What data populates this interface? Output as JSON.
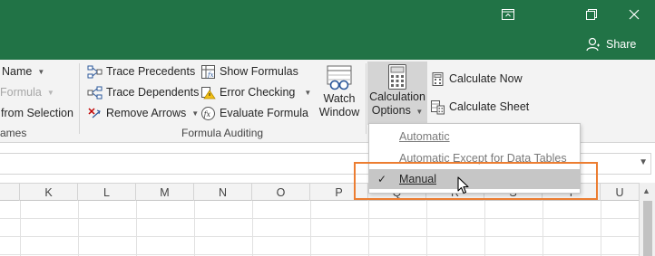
{
  "titlebar": {
    "bg": "#217346",
    "buttons": [
      "ribbon-display-icon",
      "restore-icon",
      "close-icon"
    ],
    "share_label": "Share"
  },
  "ribbon": {
    "defined_names": {
      "items": [
        {
          "label": "Name",
          "has_caret": true,
          "disabled": false
        },
        {
          "label": "Formula",
          "has_caret": true,
          "disabled": true
        },
        {
          "label": "from Selection",
          "disabled": false
        }
      ],
      "group_label": "ames"
    },
    "formula_auditing": {
      "items": [
        {
          "label": "Trace Precedents"
        },
        {
          "label": "Trace Dependents"
        },
        {
          "label": "Remove Arrows",
          "has_caret": true
        },
        {
          "label": "Show Formulas"
        },
        {
          "label": "Error Checking",
          "has_caret": true
        },
        {
          "label": "Evaluate Formula"
        }
      ],
      "watch_window": {
        "line1": "Watch",
        "line2": "Window"
      },
      "group_label": "Formula Auditing"
    },
    "calculation": {
      "options": {
        "line1": "Calculation",
        "line2": "Options"
      },
      "items": [
        {
          "label": "Calculate Now"
        },
        {
          "label": "Calculate Sheet"
        }
      ]
    }
  },
  "columns": [
    "K",
    "L",
    "M",
    "N",
    "O",
    "P",
    "Q",
    "R",
    "S",
    "T",
    "U"
  ],
  "menu": {
    "items": [
      {
        "label": "Automatic",
        "selected": false
      },
      {
        "label": "Automatic Except for Data Tables",
        "selected": false
      },
      {
        "label": "Manual",
        "selected": true
      }
    ]
  },
  "accent_color": "#ec7d31"
}
